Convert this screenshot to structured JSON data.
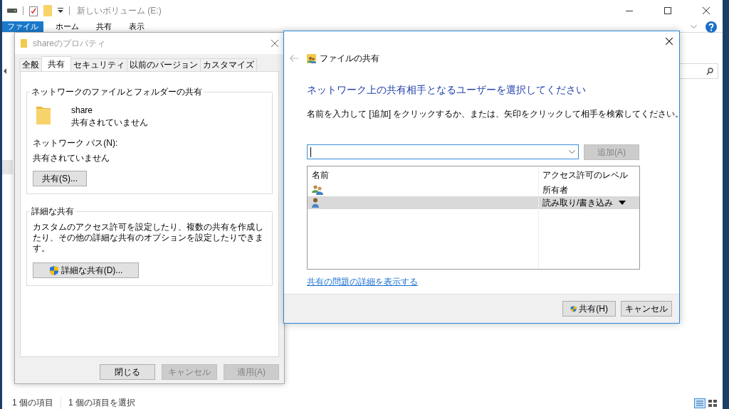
{
  "explorer": {
    "title": "新しいボリューム (E:)",
    "ribbon_tabs": [
      {
        "label": "ファイル",
        "selected": true
      },
      {
        "label": "ホーム",
        "selected": false
      },
      {
        "label": "共有",
        "selected": false
      },
      {
        "label": "表示",
        "selected": false
      }
    ],
    "status_bar": [
      "1 個の項目",
      "1 個の項目を選択"
    ]
  },
  "properties_dialog": {
    "title": "shareのプロパティ",
    "tabs": [
      {
        "label": "全般",
        "selected": false
      },
      {
        "label": "共有",
        "selected": true
      },
      {
        "label": "セキュリティ",
        "selected": false
      },
      {
        "label": "以前のバージョン",
        "selected": false
      },
      {
        "label": "カスタマイズ",
        "selected": false
      }
    ],
    "network_sharing": {
      "legend": "ネットワークのファイルとフォルダーの共有",
      "folder_name": "share",
      "folder_status": "共有されていません",
      "path_label": "ネットワーク パス(N):",
      "path_value": "共有されていません",
      "button": {
        "label": "共有(S)...",
        "shield": false,
        "disabled": false
      }
    },
    "advanced_sharing": {
      "legend": "詳細な共有",
      "description": "カスタムのアクセス許可を設定したり、複数の共有を作成したり、その他の詳細な共有のオプションを設定したりできます。",
      "button": {
        "label": "詳細な共有(D)...",
        "shield": true,
        "disabled": false
      }
    },
    "buttons": [
      {
        "label": "閉じる",
        "shield": false,
        "disabled": false
      },
      {
        "label": "キャンセル",
        "shield": false,
        "disabled": true
      },
      {
        "label": "適用(A)",
        "shield": false,
        "disabled": true
      }
    ]
  },
  "file_sharing": {
    "title": "ファイルの共有",
    "heading": "ネットワーク上の共有相手となるユーザーを選択してください",
    "instruction": "名前を入力して [追加] をクリックするか、または、矢印をクリックして相手を検索してください。",
    "add_button": {
      "label": "追加(A)",
      "shield": false,
      "disabled": true
    },
    "columns": [
      "名前",
      "アクセス許可のレベル"
    ],
    "rows": [
      {
        "kind": "group",
        "permission": "所有者",
        "selected": false
      },
      {
        "kind": "user",
        "permission": "読み取り/書き込み",
        "selected": true
      }
    ],
    "link": "共有の問題の詳細を表示する",
    "buttons": [
      {
        "label": "共有(H)",
        "shield": true,
        "disabled": false
      },
      {
        "label": "キャンセル",
        "shield": false,
        "disabled": false
      }
    ]
  }
}
